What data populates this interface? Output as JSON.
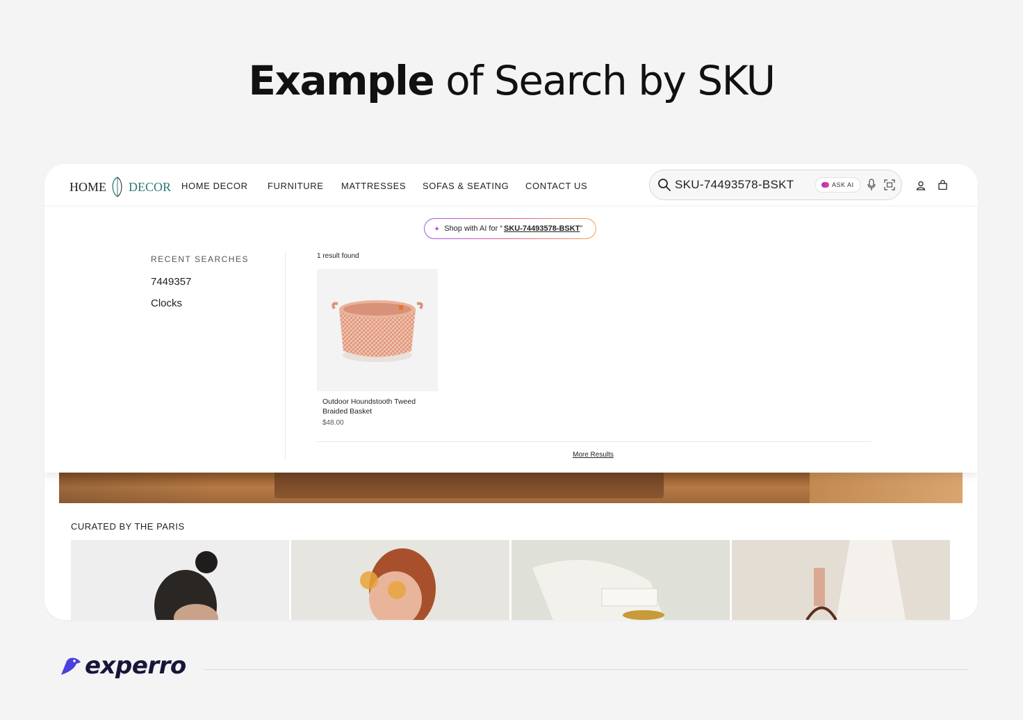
{
  "headline": {
    "bold": "Example",
    "rest": " of Search by SKU"
  },
  "store": {
    "logo_left": "HOME",
    "logo_right": "DECOR",
    "nav": [
      "HOME DECOR",
      "FURNITURE",
      "MATTRESSES",
      "SOFAS & SEATING",
      "CONTACT US"
    ]
  },
  "search": {
    "query": "SKU-74493578-BSKT",
    "ask_ai_label": "ASK AI"
  },
  "dropdown": {
    "shop_ai_prefix": "Shop with AI for “",
    "shop_ai_query": "SKU-74493578-BSKT",
    "shop_ai_suffix": "”",
    "recent_heading": "RECENT SEARCHES",
    "recent": [
      "7449357",
      "Clocks"
    ],
    "result_count": "1 result found",
    "product": {
      "title": "Outdoor Houndstooth Tweed Braided Basket",
      "price": "$48.00"
    },
    "more_results": "More Results"
  },
  "curated_heading": "CURATED BY THE PARIS",
  "brand": "experro",
  "colors": {
    "logo_accent": "#2c7a73",
    "brand": "#16163a",
    "brand_bird": "#4b3fe0"
  }
}
